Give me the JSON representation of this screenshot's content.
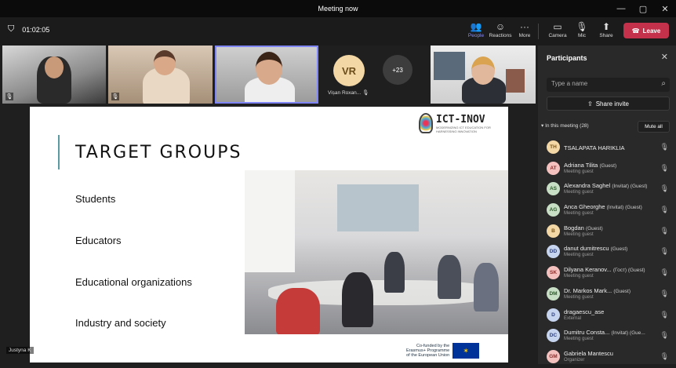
{
  "window": {
    "title": "Meeting now",
    "controls": [
      "—",
      "▢",
      "✕"
    ]
  },
  "toolbar": {
    "timer": "01:02:05",
    "buttons": [
      {
        "label": "People",
        "icon": "people-icon",
        "glyph": "👥",
        "active": true
      },
      {
        "label": "Reactions",
        "icon": "reactions-icon",
        "glyph": "☺",
        "active": false
      },
      {
        "label": "More",
        "icon": "more-icon",
        "glyph": "···",
        "active": false
      },
      {
        "label": "Camera",
        "icon": "camera-icon",
        "glyph": "▭",
        "active": false
      },
      {
        "label": "Mic",
        "icon": "mic-off-icon",
        "glyph": "🎙",
        "active": false
      },
      {
        "label": "Share",
        "icon": "share-icon",
        "glyph": "⬆",
        "active": false
      }
    ],
    "leave_label": "Leave",
    "leave_color": "#c4314b"
  },
  "stage": {
    "avatar_initials": "VR",
    "avatar_name": "Vișan Roxan...",
    "more_count": "+23",
    "presenter_name": "Justyna K"
  },
  "slide": {
    "title": "TARGET GROUPS",
    "items": [
      "Students",
      "Educators",
      "Educational organizations",
      "Industry and society"
    ],
    "logo_name": "ICT-INOV",
    "logo_tagline": "MODERNIZING ICT EDUCATION FOR HARNESSING INNOVATION",
    "eu_text": [
      "Co-funded by the",
      "Erasmus+ Programme",
      "of the European Union"
    ],
    "accent_color": "#5a9aa0"
  },
  "panel": {
    "title": "Participants",
    "search_placeholder": "Type a name",
    "share_label": "Share invite",
    "in_meeting_label": "In this meeting (28)",
    "mute_all_label": "Mute all",
    "participants": [
      {
        "initials": "TH",
        "name": "TSALAPATA HARIKLIA",
        "tag": "",
        "role": "",
        "bg": "#f3d7a4",
        "fg": "#7a5518"
      },
      {
        "initials": "AT",
        "name": "Adriana Tilita",
        "tag": "(Guest)",
        "role": "Meeting guest",
        "bg": "#f4c1bf",
        "fg": "#8a2e2a"
      },
      {
        "initials": "AS",
        "name": "Alexandra Saghel",
        "tag": "(Invitat) (Guest)",
        "role": "Meeting guest",
        "bg": "#c8dfc6",
        "fg": "#2e5a2a"
      },
      {
        "initials": "AG",
        "name": "Anca Gheorghe",
        "tag": "(Invitat) (Guest)",
        "role": "Meeting guest",
        "bg": "#c8dfc6",
        "fg": "#2e5a2a"
      },
      {
        "initials": "B",
        "name": "Bogdan",
        "tag": "(Guest)",
        "role": "Meeting guest",
        "bg": "#f3d7a4",
        "fg": "#7a5518"
      },
      {
        "initials": "DD",
        "name": "danut dumitrescu",
        "tag": "(Guest)",
        "role": "Meeting guest",
        "bg": "#c7d4f0",
        "fg": "#2b3e7a"
      },
      {
        "initials": "SK",
        "name": "Dilyana Keranov...",
        "tag": "(Гост) (Guest)",
        "role": "Meeting guest",
        "bg": "#f4c1bf",
        "fg": "#8a2e2a"
      },
      {
        "initials": "DM",
        "name": "Dr. Markos Mark...",
        "tag": "(Guest)",
        "role": "Meeting guest",
        "bg": "#c8dfc6",
        "fg": "#2e5a2a"
      },
      {
        "initials": "D",
        "name": "dragaescu_ase",
        "tag": "",
        "role": "External",
        "bg": "#c7d4f0",
        "fg": "#2b3e7a"
      },
      {
        "initials": "DC",
        "name": "Dumitru Consta...",
        "tag": "(Invitat) (Gue...",
        "role": "Meeting guest",
        "bg": "#c7d4f0",
        "fg": "#2b3e7a"
      },
      {
        "initials": "GM",
        "name": "Gabriela Mantescu",
        "tag": "",
        "role": "Organizer",
        "bg": "#f4c1bf",
        "fg": "#8a2e2a"
      }
    ]
  }
}
